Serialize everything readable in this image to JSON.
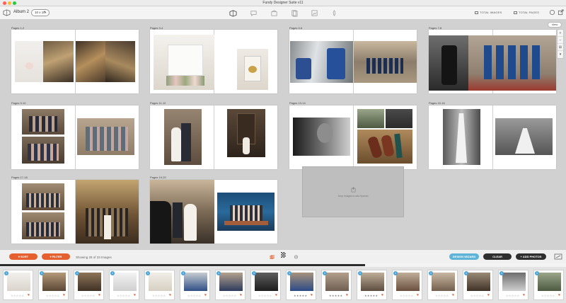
{
  "window": {
    "title": "Fundy Designer Suite v11"
  },
  "toolbar": {
    "album_label": "Album 2",
    "album_size": "10 x 10",
    "total_images_label": "TOTAL IMAGES",
    "total_pages_label": "TOTAL PAGES",
    "center_icons": [
      "album-icon",
      "speech-bubble-icon",
      "bag-icon",
      "pages-icon",
      "image-frame-icon",
      "paint-icon"
    ]
  },
  "canvas": {
    "view_button": "View",
    "side_tools": [
      "+",
      "−",
      "⊞",
      "▾"
    ],
    "spreads": [
      {
        "label": "Pages 1-2"
      },
      {
        "label": "Pages 3-4"
      },
      {
        "label": "Pages 5-6"
      },
      {
        "label": "Pages 7-8"
      },
      {
        "label": "Pages 9-10"
      },
      {
        "label": "Pages 11-12"
      },
      {
        "label": "Pages 13-14"
      },
      {
        "label": "Pages 15-16"
      },
      {
        "label": "Pages 17-18"
      },
      {
        "label": "Pages 19-20"
      }
    ],
    "dropzone_text": "Drop images to add Spread"
  },
  "actionbar": {
    "sort_label": "SORT",
    "filter_label": "FILTER",
    "showing_text": "Showing 25 of 33 Images",
    "design_wizard_label": "DESIGN WIZARD",
    "clear_label": "CLEAR",
    "add_photos_label": "+ ADD PHOTOS"
  },
  "progress": {
    "fraction": 0.645
  },
  "tray": {
    "thumbs": [
      {
        "badge": "1",
        "stars": "☆☆☆☆☆"
      },
      {
        "badge": "1",
        "stars": "☆☆☆☆☆"
      },
      {
        "badge": "1",
        "stars": "☆☆☆☆☆"
      },
      {
        "badge": "1",
        "stars": "☆☆☆☆☆"
      },
      {
        "badge": "1",
        "stars": "☆☆☆☆☆"
      },
      {
        "badge": "1",
        "stars": "☆☆☆☆☆"
      },
      {
        "badge": "1",
        "stars": "☆☆☆☆☆"
      },
      {
        "badge": "1",
        "stars": "☆☆☆☆☆"
      },
      {
        "badge": "1",
        "stars": "★★★★★"
      },
      {
        "badge": "1",
        "stars": "★★★★★"
      },
      {
        "badge": "1",
        "stars": "★★★★★"
      },
      {
        "badge": "1",
        "stars": "☆☆☆☆☆"
      },
      {
        "badge": "1",
        "stars": "☆☆☆☆☆"
      },
      {
        "badge": "1",
        "stars": "☆☆☆☆☆"
      },
      {
        "badge": "1",
        "stars": "☆☆☆☆☆"
      },
      {
        "badge": "1",
        "stars": "☆☆☆☆☆"
      }
    ]
  },
  "colors": {
    "accent_orange": "#e5602e",
    "accent_blue": "#5eb3d8",
    "dark_button": "#2f2f2f",
    "badge_blue": "#4aa3d6"
  }
}
